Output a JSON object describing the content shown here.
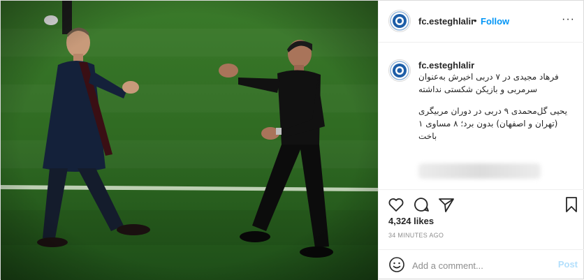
{
  "account": {
    "username": "fc.esteghlalir",
    "separator": "•",
    "follow_label": "Follow"
  },
  "caption": {
    "username": "fc.esteghlalir",
    "paragraph_1": "فرهاد مجیدی در ۷ دربی اخیرش به‌عنوان سرمربی و بازیکن شکستی نداشته",
    "paragraph_2": "یحیی گل‌محمدی ۹ دربی در دوران مربیگری (تهران و اصفهان) بدون برد؛ ۸ مساوی ۱ باخت"
  },
  "stats": {
    "likes": "4,324 likes",
    "time": "34 MINUTES AGO"
  },
  "add_comment": {
    "placeholder": "Add a comment...",
    "post_label": "Post"
  },
  "icons": {
    "avatar": "esteghlal-logo-icon",
    "more": "more-options-icon",
    "like": "heart-icon",
    "comment": "comment-icon",
    "share": "share-icon",
    "save": "bookmark-icon",
    "emoji": "emoji-icon"
  },
  "colors": {
    "link_blue": "#0095f6",
    "post_disabled": "#b2dffc",
    "grass": "#2f6a22",
    "logo_blue": "#1d5ea8"
  }
}
